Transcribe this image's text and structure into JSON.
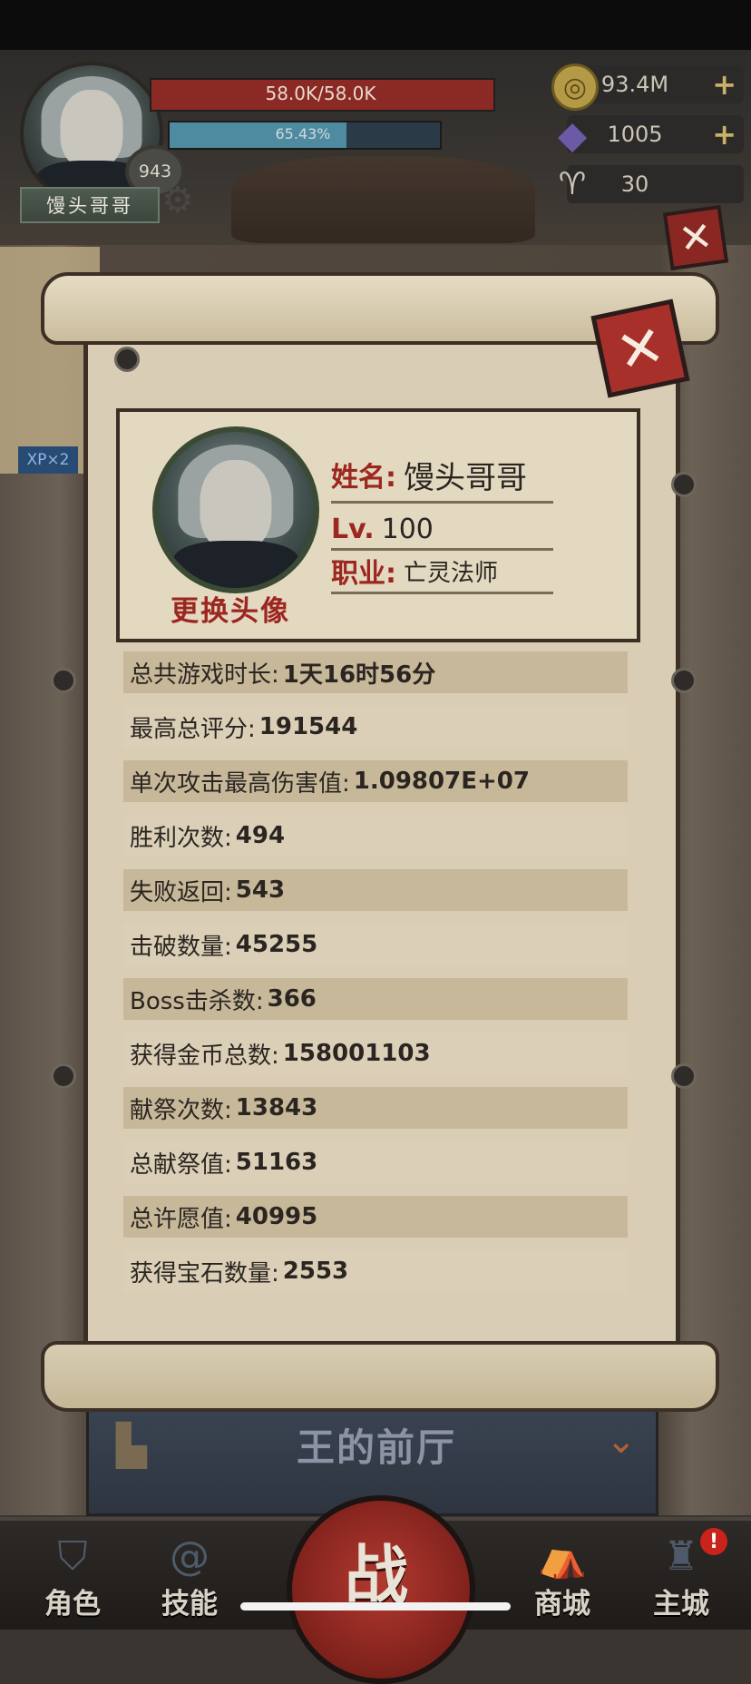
{
  "hud": {
    "hp_text": "58.0K/58.0K",
    "xp_text": "65.43%",
    "xp_progress": 0.6543,
    "level": "943",
    "player_name": "馒头哥哥",
    "coins": "93.4M",
    "gems": "1005",
    "ram_tokens": "30",
    "plus": "+"
  },
  "background": {
    "xp_badge": "XP×2",
    "close_symbol": "✕"
  },
  "profile": {
    "close_symbol": "✕",
    "name_label": "姓名:",
    "name_value": "馒头哥哥",
    "level_label": "Lv.",
    "level_value": "100",
    "class_label": "职业:",
    "class_value": "亡灵法师",
    "change_avatar": "更换头像"
  },
  "stats": [
    {
      "label": "总共游戏时长:",
      "value": "1天16时56分"
    },
    {
      "label": "最高总评分:",
      "value": "191544"
    },
    {
      "label": "单次攻击最高伤害值:",
      "value": "1.09807E+07"
    },
    {
      "label": "胜利次数:",
      "value": "494"
    },
    {
      "label": "失败返回:",
      "value": "543"
    },
    {
      "label": "击破数量:",
      "value": "45255"
    },
    {
      "label": "Boss击杀数:",
      "value": "366"
    },
    {
      "label": "获得金币总数:",
      "value": "158001103"
    },
    {
      "label": "献祭次数:",
      "value": "13843"
    },
    {
      "label": "总献祭值:",
      "value": "51163"
    },
    {
      "label": "总许愿值:",
      "value": "40995"
    },
    {
      "label": "获得宝石数量:",
      "value": "2553"
    }
  ],
  "location": {
    "title": "王的前厅"
  },
  "nav": {
    "character": "角色",
    "skills": "技能",
    "battle": "战",
    "shop": "商城",
    "city": "主城",
    "alert": "!"
  },
  "icons": {
    "coin": "coin-icon",
    "gem": "gem-icon",
    "ram": "ram-skull-icon",
    "gear": "gear-icon"
  },
  "colors": {
    "accent_red": "#9c2620",
    "parchment": "#d9ceb5",
    "hp_red": "#8b2a24",
    "xp_blue": "#4e8aa0"
  }
}
